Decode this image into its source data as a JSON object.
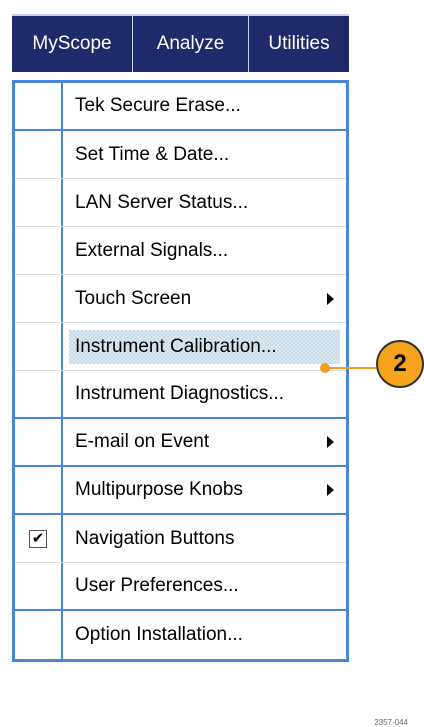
{
  "menubar": {
    "items": [
      "MyScope",
      "Analyze",
      "Utilities"
    ]
  },
  "menu": {
    "items": [
      {
        "label": "Tek Secure Erase...",
        "checked": false,
        "submenu": false
      },
      {
        "label": "Set Time & Date...",
        "checked": false,
        "submenu": false
      },
      {
        "label": "LAN Server Status...",
        "checked": false,
        "submenu": false
      },
      {
        "label": "External Signals...",
        "checked": false,
        "submenu": false
      },
      {
        "label": "Touch Screen",
        "checked": false,
        "submenu": true
      },
      {
        "label": "Instrument Calibration...",
        "checked": false,
        "submenu": false,
        "highlighted": true
      },
      {
        "label": "Instrument Diagnostics...",
        "checked": false,
        "submenu": false
      },
      {
        "label": "E-mail on Event",
        "checked": false,
        "submenu": true
      },
      {
        "label": "Multipurpose Knobs",
        "checked": false,
        "submenu": true
      },
      {
        "label": "Navigation Buttons",
        "checked": true,
        "submenu": false
      },
      {
        "label": "User Preferences...",
        "checked": false,
        "submenu": false
      },
      {
        "label": "Option Installation...",
        "checked": false,
        "submenu": false
      }
    ]
  },
  "callout": {
    "number": "2",
    "color": "#f6a21a"
  },
  "figure_id": "2357-044",
  "colors": {
    "menubar_bg": "#1f2a6b",
    "menu_border": "#4a86d6"
  }
}
